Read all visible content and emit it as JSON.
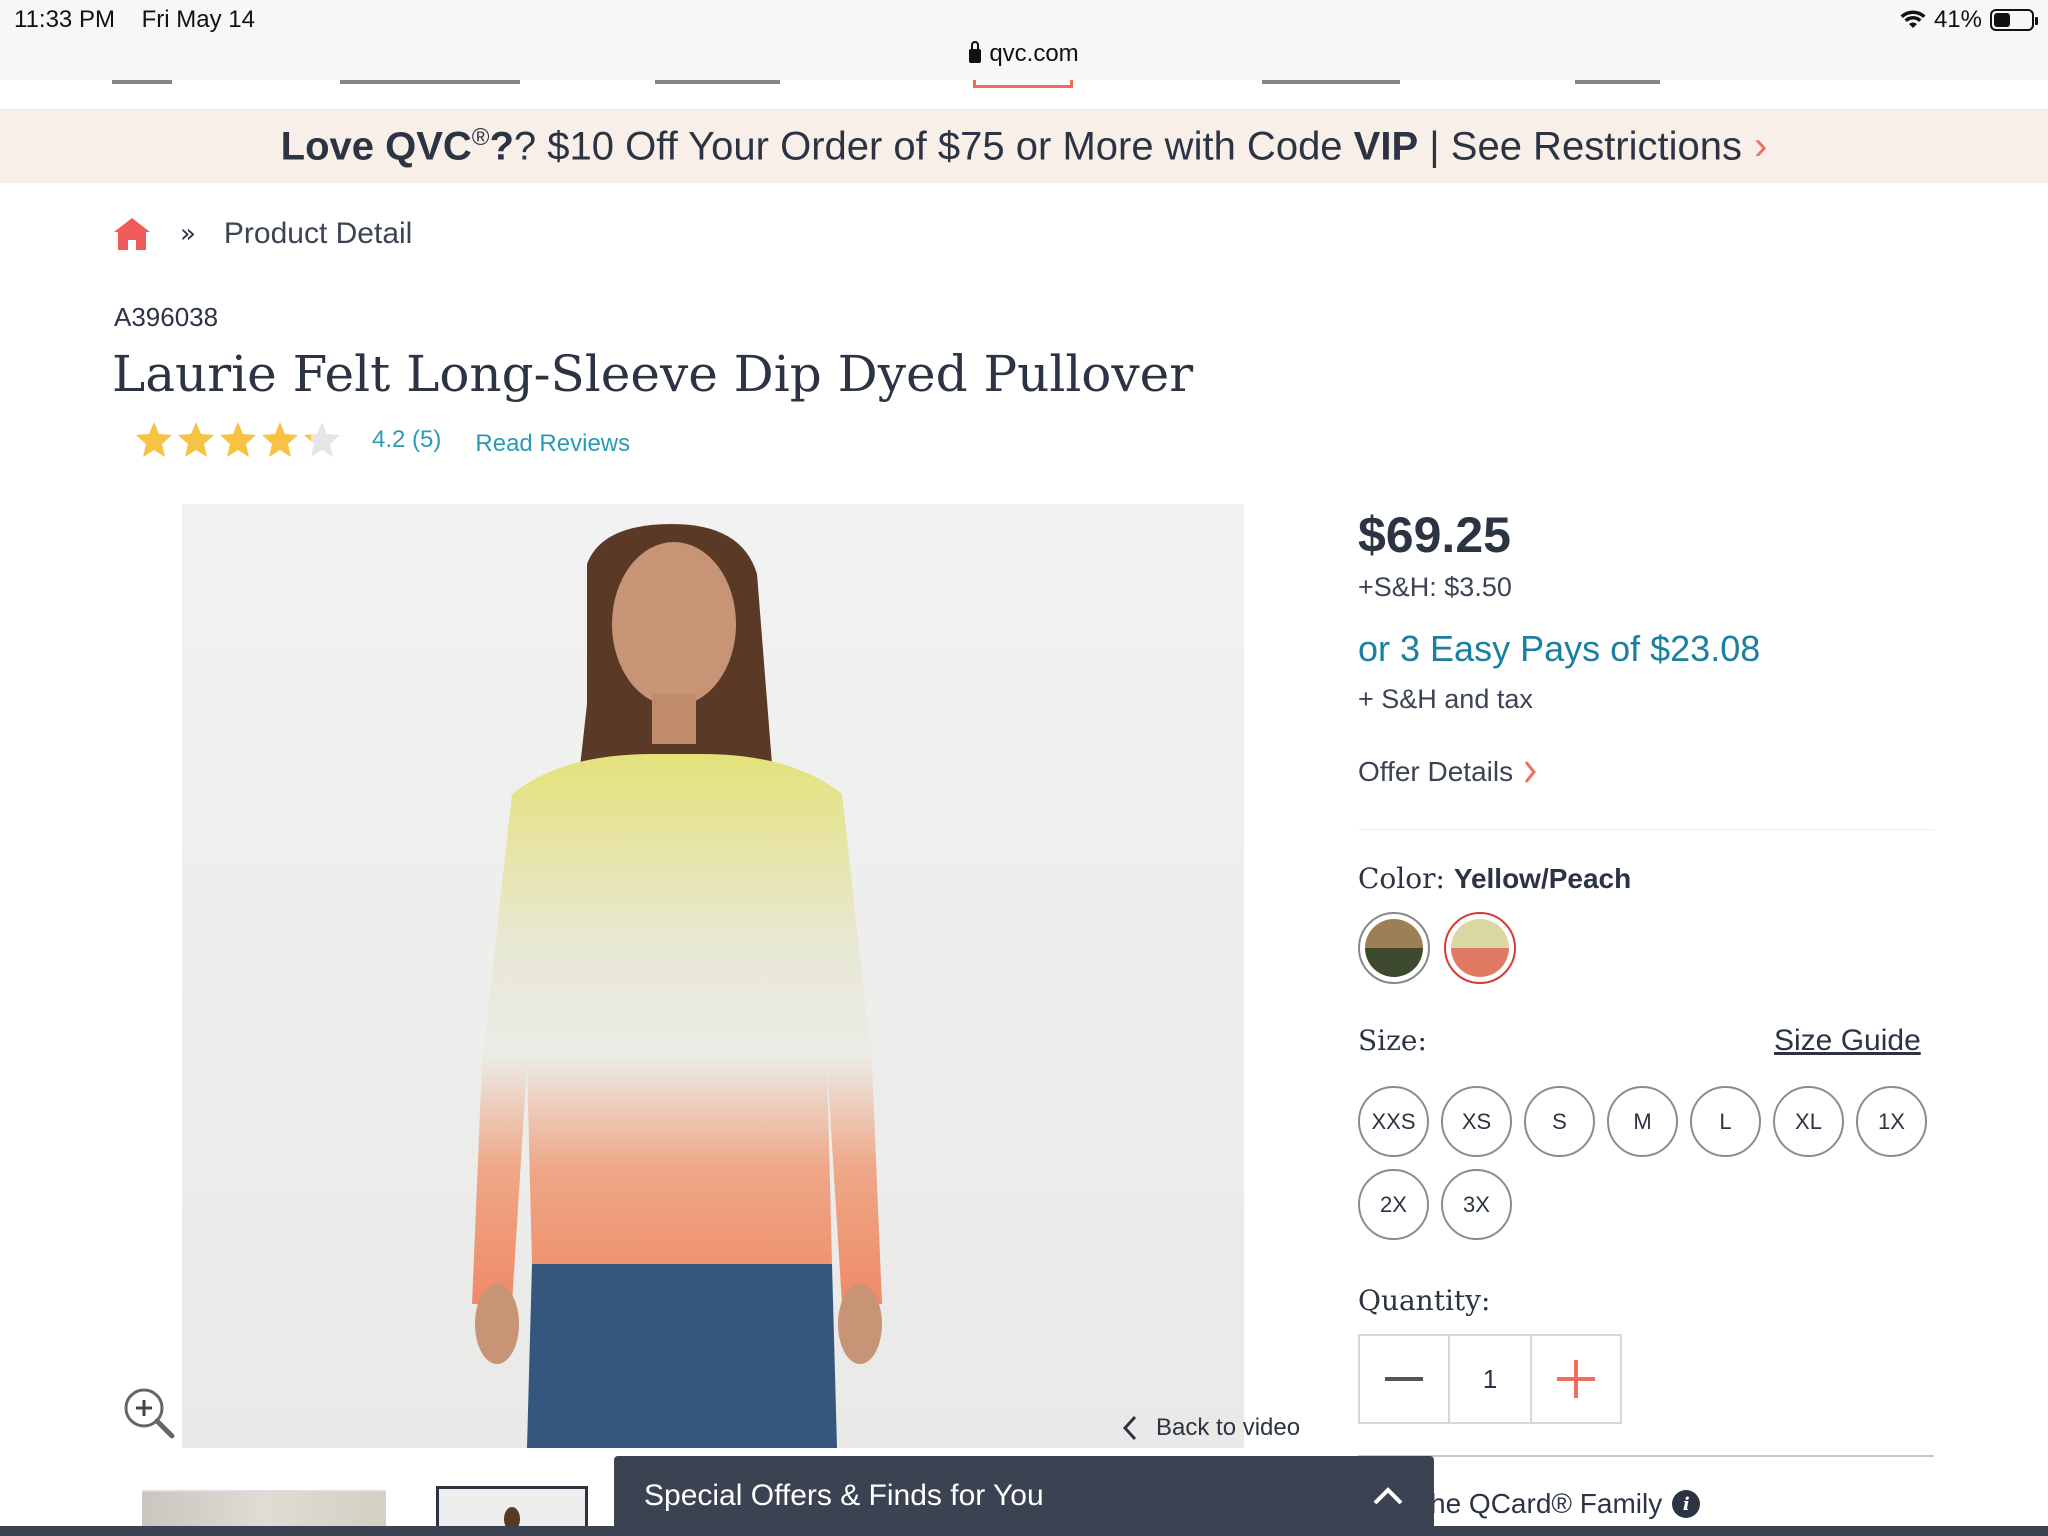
{
  "status_bar": {
    "time": "11:33 PM",
    "date": "Fri May 14",
    "battery": "41%"
  },
  "browser": {
    "url": "qvc.com"
  },
  "promo": {
    "part1": "Love QVC",
    "reg": "®",
    "part2": "? $10 Off Your Order of $75 or More with Code ",
    "code": "VIP",
    "part3": " | See Restrictions",
    "chevron": "›"
  },
  "breadcrumb": {
    "separator": "»",
    "current": "Product Detail"
  },
  "product": {
    "sku": "A396038",
    "title": "Laurie Felt Long-Sleeve Dip Dyed Pullover",
    "rating": 4.2,
    "rating_text": "4.2",
    "review_count": "(5)",
    "read_reviews": "Read Reviews",
    "back_to_video": "Back to video"
  },
  "pricing": {
    "price": "$69.25",
    "shipping": "+S&H: $3.50",
    "easy_pay": "or 3 Easy Pays of $23.08",
    "easy_pay_note": "+ S&H and tax",
    "offer_details": "Offer Details"
  },
  "color": {
    "label": "Color: ",
    "selected": "Yellow/Peach",
    "swatches": [
      {
        "name": "Olive",
        "top": "#9c7f55",
        "bottom": "#3d4a2e",
        "selected": false
      },
      {
        "name": "Yellow/Peach",
        "top": "#d9d7a2",
        "bottom": "#e07a63",
        "selected": true
      }
    ]
  },
  "size": {
    "label": "Size:",
    "guide": "Size Guide",
    "options": [
      "XXS",
      "XS",
      "S",
      "M",
      "L",
      "XL",
      "1X",
      "2X",
      "3X"
    ]
  },
  "quantity": {
    "label": "Quantity:",
    "value": "1"
  },
  "qcard": {
    "text": "he QCard® Family",
    "info": "i"
  },
  "offers_drawer": {
    "title": "Special Offers & Finds for You"
  },
  "colors": {
    "accent": "#f06c5c",
    "link": "#2a9bb5",
    "teal": "#1a7fa1",
    "navy": "#2c3444",
    "star": "#f6c342"
  }
}
